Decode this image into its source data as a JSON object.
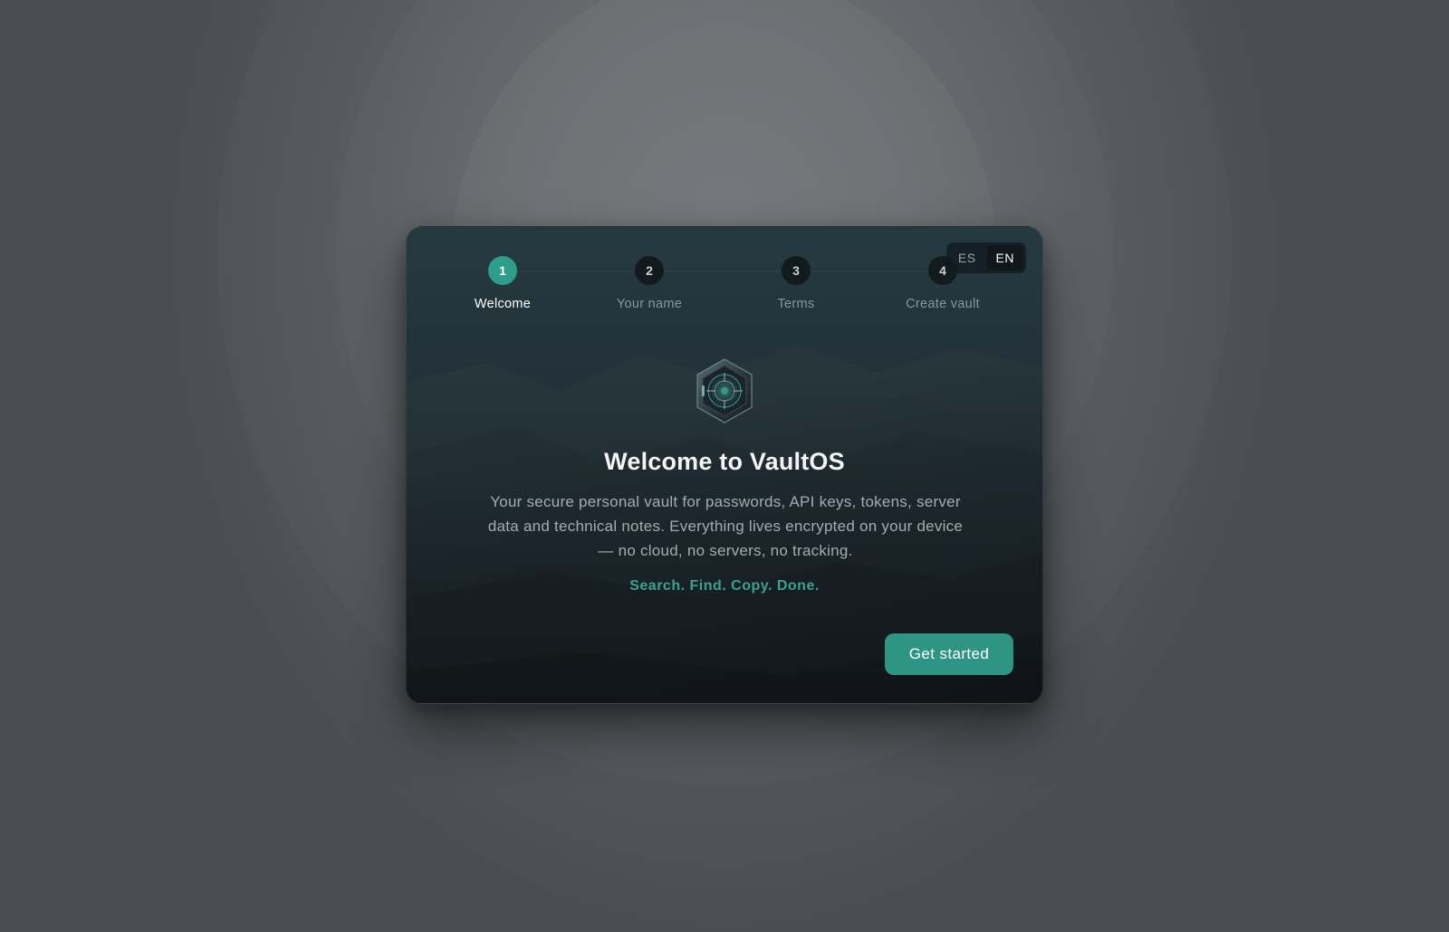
{
  "language_switcher": {
    "options": [
      "ES",
      "EN"
    ],
    "selected": "EN"
  },
  "stepper": {
    "current_step": 1,
    "steps": [
      {
        "number": "1",
        "label": "Welcome"
      },
      {
        "number": "2",
        "label": "Your name"
      },
      {
        "number": "3",
        "label": "Terms"
      },
      {
        "number": "4",
        "label": "Create vault"
      }
    ]
  },
  "main": {
    "emblem_icon": "vault-hexagon-icon",
    "title": "Welcome to VaultOS",
    "description": "Your secure personal vault for passwords, API keys, tokens, server data and technical notes. Everything lives encrypted on your device — no cloud, no servers, no tracking.",
    "tagline": "Search. Find. Copy. Done.",
    "cta_label": "Get started"
  },
  "colors": {
    "accent": "#2f9d8c",
    "card_bg": "#1e2b31",
    "page_bg": "#4a4e52"
  }
}
